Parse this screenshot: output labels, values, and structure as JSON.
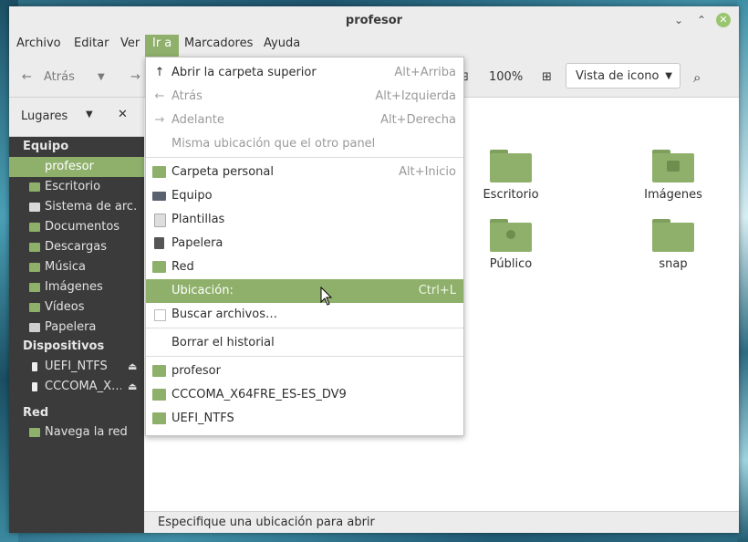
{
  "window": {
    "title": "profesor"
  },
  "menubar": [
    "Archivo",
    "Editar",
    "Ver",
    "Ir a",
    "Marcadores",
    "Ayuda"
  ],
  "toolbar": {
    "back": "Atrás",
    "zoom": "100%",
    "view_mode": "Vista de icono"
  },
  "places": {
    "label": "Lugares"
  },
  "sidebar": {
    "sections": [
      {
        "header": "Equipo",
        "items": [
          "profesor",
          "Escritorio",
          "Sistema de arc…",
          "Documentos",
          "Descargas",
          "Música",
          "Imágenes",
          "Vídeos",
          "Papelera"
        ]
      },
      {
        "header": "Dispositivos",
        "items": [
          "UEFI_NTFS",
          "CCCOMA_X…"
        ]
      },
      {
        "header": "Red",
        "items": [
          "Navega la red"
        ]
      }
    ]
  },
  "files": [
    "Escritorio",
    "Imágenes",
    "Público",
    "snap"
  ],
  "menu": {
    "items": [
      {
        "label": "Abrir la carpeta superior",
        "accel": "Alt+Arriba"
      },
      {
        "label": "Atrás",
        "accel": "Alt+Izquierda"
      },
      {
        "label": "Adelante",
        "accel": "Alt+Derecha"
      },
      {
        "label": "Misma ubicación que el otro panel",
        "accel": ""
      },
      {
        "label": "Carpeta personal",
        "accel": "Alt+Inicio"
      },
      {
        "label": "Equipo",
        "accel": ""
      },
      {
        "label": "Plantillas",
        "accel": ""
      },
      {
        "label": "Papelera",
        "accel": ""
      },
      {
        "label": "Red",
        "accel": ""
      },
      {
        "label": "Ubicación:",
        "accel": "Ctrl+L"
      },
      {
        "label": "Buscar archivos…",
        "accel": ""
      },
      {
        "label": "Borrar el historial",
        "accel": ""
      },
      {
        "label": "profesor",
        "accel": ""
      },
      {
        "label": "CCCOMA_X64FRE_ES-ES_DV9",
        "accel": ""
      },
      {
        "label": "UEFI_NTFS",
        "accel": ""
      }
    ]
  },
  "status": "Especifique una ubicación para abrir",
  "colors": {
    "accent": "#8fb06b",
    "sidebar_bg": "#3b3b3b",
    "chrome_bg": "#ececec"
  }
}
